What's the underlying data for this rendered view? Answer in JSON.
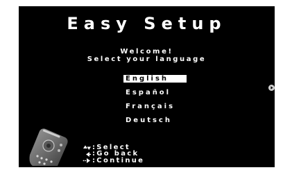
{
  "screen": {
    "title": "Easy Setup",
    "welcome": "Welcome!",
    "prompt": "Select your language"
  },
  "languages": [
    {
      "label": "English",
      "selected": true
    },
    {
      "label": "Español",
      "selected": false
    },
    {
      "label": "Français",
      "selected": false
    },
    {
      "label": "Deutsch",
      "selected": false
    }
  ],
  "instructions": {
    "select": ":Select",
    "back": ":Go back",
    "continue": ":Continue"
  },
  "icons": {
    "next": "next-arrow-icon",
    "remote": "remote-control-icon",
    "select": "up-down-arrows-icon",
    "back": "left-arrow-icon",
    "continue": "right-arrow-icon"
  },
  "colors": {
    "background": "#000000",
    "text": "#ffffff",
    "highlight": "#ffffff"
  }
}
